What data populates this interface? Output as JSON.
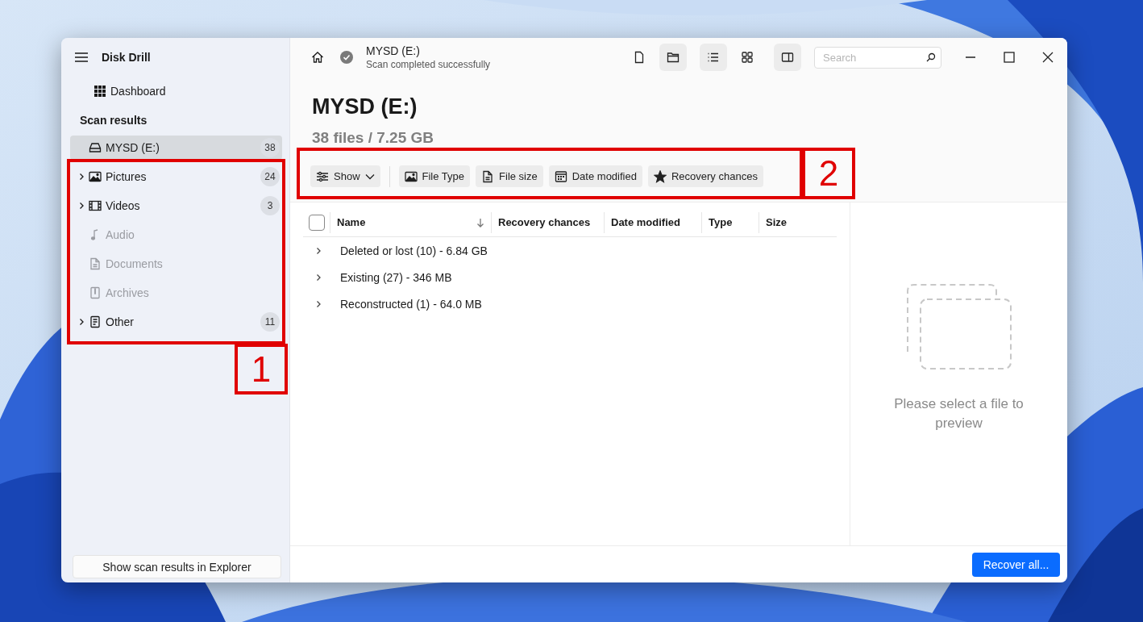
{
  "window": {
    "title": "Disk Drill"
  },
  "sidebar": {
    "dashboard": "Dashboard",
    "section": "Scan results",
    "items": [
      {
        "label": "MYSD (E:)",
        "count": "38",
        "selected": true,
        "expandable": false,
        "disabled": false
      },
      {
        "label": "Pictures",
        "count": "24",
        "selected": false,
        "expandable": true,
        "disabled": false
      },
      {
        "label": "Videos",
        "count": "3",
        "selected": false,
        "expandable": true,
        "disabled": false
      },
      {
        "label": "Audio",
        "selected": false,
        "expandable": false,
        "disabled": true
      },
      {
        "label": "Documents",
        "selected": false,
        "expandable": false,
        "disabled": true
      },
      {
        "label": "Archives",
        "selected": false,
        "expandable": false,
        "disabled": true
      },
      {
        "label": "Other",
        "count": "11",
        "selected": false,
        "expandable": true,
        "disabled": false
      }
    ],
    "footer_button": "Show scan results in Explorer"
  },
  "topbar": {
    "device": "MYSD (E:)",
    "status": "Scan completed successfully",
    "view_buttons": [
      {
        "selected": false
      },
      {
        "selected": true
      },
      {
        "selected": true
      },
      {
        "selected": false
      },
      {
        "selected": true
      }
    ],
    "search": {
      "placeholder": "Search"
    }
  },
  "heading": {
    "title": "MYSD (E:)",
    "subtitle": "38 files / 7.25 GB"
  },
  "filters": [
    "Show",
    "File Type",
    "File size",
    "Date modified",
    "Recovery chances"
  ],
  "table": {
    "select_all": {
      "checked": false
    },
    "columns": [
      {
        "label": "Name",
        "sorted": true
      },
      {
        "label": "Recovery chances",
        "sorted": false
      },
      {
        "label": "Date modified",
        "sorted": false
      },
      {
        "label": "Type",
        "sorted": false
      },
      {
        "label": "Size",
        "sorted": false
      }
    ],
    "rows": [
      {
        "label": "Deleted or lost (10) - 6.84 GB",
        "expanded": false
      },
      {
        "label": "Existing (27) - 346 MB",
        "expanded": false
      },
      {
        "label": "Reconstructed (1) - 64.0 MB",
        "expanded": false
      }
    ]
  },
  "preview": {
    "message": "Please select a file to preview"
  },
  "footer": {
    "button": "Recover all..."
  },
  "annotations": [
    {
      "label": "1"
    },
    {
      "label": "2"
    }
  ]
}
